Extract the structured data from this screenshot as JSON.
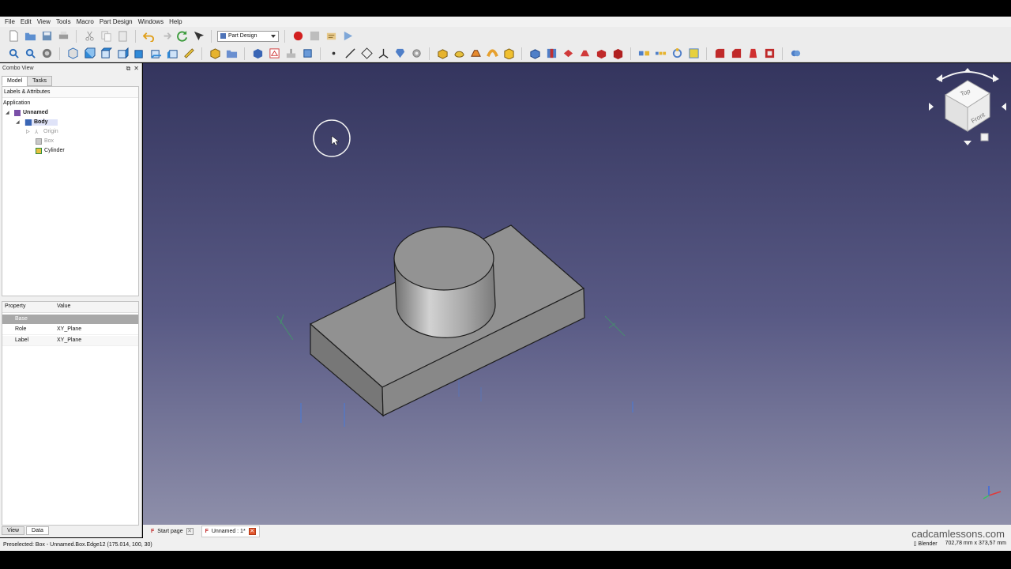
{
  "menu": [
    "File",
    "Edit",
    "View",
    "Tools",
    "Macro",
    "Part Design",
    "Windows",
    "Help"
  ],
  "toolbar": {
    "workbench": "Part Design"
  },
  "combo_view": {
    "title": "Combo View",
    "tabs": [
      "Model",
      "Tasks"
    ],
    "tree_header": "Labels & Attributes",
    "tree_root": "Application",
    "items": [
      {
        "label": "Unnamed"
      },
      {
        "label": "Body"
      },
      {
        "label": "Origin"
      },
      {
        "label": "Box"
      },
      {
        "label": "Cylinder"
      }
    ]
  },
  "properties": {
    "col_property": "Property",
    "col_value": "Value",
    "group": "Base",
    "rows": [
      {
        "name": "Role",
        "value": "XY_Plane"
      },
      {
        "name": "Label",
        "value": "XY_Plane"
      }
    ],
    "bottom_tabs": [
      "View",
      "Data"
    ]
  },
  "nav_cube": {
    "top": "Top",
    "front": "Front"
  },
  "doc_tabs": [
    "Start page",
    "Unnamed : 1*"
  ],
  "status": {
    "preselected": "Preselected: Box - Unnamed.Box.Edge12 (175.014, 100, 30)",
    "nav_style": "Blender",
    "dimensions": "702,78 mm x 373,57 mm"
  },
  "watermark": "cadcamlessons.com",
  "colors": {
    "viewport_top": "#34355e",
    "viewport_bottom": "#8e8faa",
    "record": "#d21f1f"
  }
}
